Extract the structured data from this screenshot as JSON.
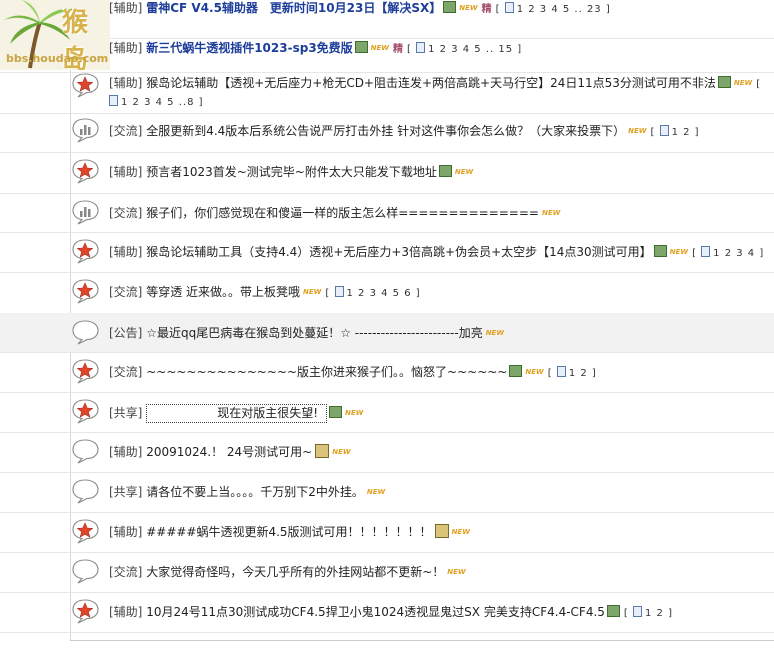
{
  "site": {
    "logo_text": "bbs.houdao.com",
    "logo_mark": "猴岛"
  },
  "colors": {
    "accent_blue": "#1d3d9a",
    "new_badge": "#e0a020",
    "row_shade": "#f2f2f2"
  },
  "labels": {
    "new": "NEW",
    "hot": "精"
  },
  "rows": [
    {
      "bubble": "star",
      "tag": "[辅助]",
      "subject": "雷神CF V4.5辅助器　更新时间10月23日【解决SX】",
      "bold": true,
      "img": true,
      "new": true,
      "hot": true,
      "pages": "1 2 3 4 5 .. 23"
    },
    {
      "bubble": "star",
      "tag": "[辅助]",
      "subject": "新三代蜗牛透视插件1023-sp3免费版",
      "bold": true,
      "img": true,
      "new": true,
      "hot": true,
      "pages": "1 2 3 4 5 .. 15"
    },
    {
      "bubble": "star",
      "tag": "[辅助]",
      "subject": "猴岛论坛辅助【透视+无后座力+枪无CD+阻击连发+两倍高跳+天马行空】24日11点53分测试可用不非法",
      "img": true,
      "new": true,
      "pages": "1 2 3 4 5 ..8"
    },
    {
      "bubble": "poll",
      "tag": "[交流]",
      "subject": "全服更新到4.4版本后系统公告说严厉打击外挂 针对这件事你会怎么做？（大家来投票下）",
      "new": true,
      "pages": "1 2"
    },
    {
      "bubble": "star",
      "tag": "[辅助]",
      "subject": "预言者1023首发~测试完毕~附件太大只能发下载地址",
      "img": true,
      "new": true
    },
    {
      "bubble": "poll",
      "tag": "[交流]",
      "subject": "猴子们，你们感觉现在和傻逼一样的版主怎么样==============",
      "new": true
    },
    {
      "bubble": "star",
      "tag": "[辅助]",
      "subject": "猴岛论坛辅助工具（支持4.4）透视+无后座力+3倍高跳+伪会员+太空步【14点30测试可用】",
      "img": true,
      "new": true,
      "pages": "1 2 3 4"
    },
    {
      "bubble": "star",
      "tag": "[交流]",
      "subject": "等穿透 近来做。。带上板凳哦",
      "new": true,
      "pages": "1 2 3 4 5 6"
    },
    {
      "bubble": "plain",
      "tag": "[公告]",
      "subject": "☆最近qq尾巴病毒在猴岛到处蔓延！☆ ------------------------加亮",
      "new": true,
      "shaded": true
    },
    {
      "bubble": "star",
      "tag": "[交流]",
      "subject": "~~~~~~~~~~~~~~~版主你进来猴子们。。恼怒了~~~~~~",
      "img": true,
      "new": true,
      "pages": "1 2"
    },
    {
      "bubble": "star",
      "tag": "[共享]",
      "subject": "现在对版主很失望!",
      "boxed": true,
      "img": true,
      "new": true
    },
    {
      "bubble": "plain",
      "tag": "[辅助]",
      "subject": "20091024.！ 24号测试可用~",
      "attach": true,
      "new": true
    },
    {
      "bubble": "plain",
      "tag": "[共享]",
      "subject": "请各位不要上当。。。。千万别下2中外挂。",
      "new": true
    },
    {
      "bubble": "star",
      "tag": "[辅助]",
      "subject": "#####蜗牛透视更新4.5版测试可用！！！！！！！",
      "attach": true,
      "new": true
    },
    {
      "bubble": "plain",
      "tag": "[交流]",
      "subject": "大家觉得奇怪吗，今天几乎所有的外挂网站都不更新~！",
      "new": true
    },
    {
      "bubble": "star",
      "tag": "[辅助]",
      "subject": "10月24号11点30测试成功CF4.5捍卫小鬼1024透视显鬼过SX 完美支持CF4.4-CF4.5",
      "img": true,
      "pages": "1 2"
    }
  ]
}
